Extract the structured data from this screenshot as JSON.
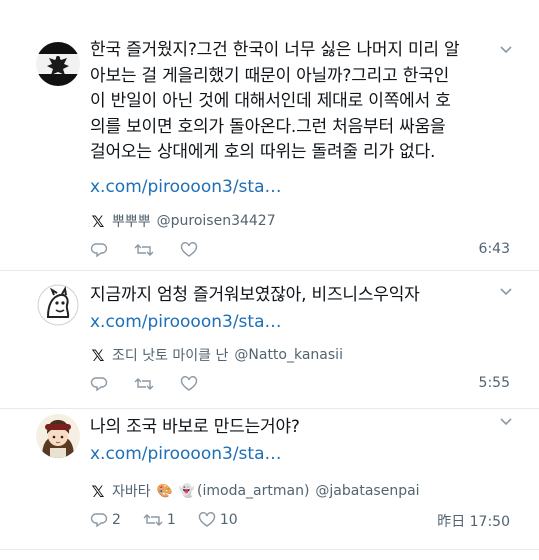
{
  "posts": [
    {
      "lines": [
        "한국 즐거웠지?그건 한국이 너무 싫은 나머지 미리 알",
        "아보는 걸 게을리했기 때문이 아닐까?그리고 한국인",
        "이 반일이 아닌 것에 대해서인데 제대로 이쪽에서 호",
        "의를 보이면 호의가 돌아온다.그런 처음부터 싸움을",
        "걸어오는 상대에게 호의 따위는 돌려줄 리가 없다."
      ],
      "link": "x.com/piroooon3/sta…",
      "quote_name": "뿌뿌뿌",
      "quote_handle": "@puroisen34427",
      "reply_count": "",
      "retweet_count": "",
      "like_count": "",
      "time": "6:43",
      "avatar": "prussian-eagle-avatar-icon"
    },
    {
      "lines": [
        "지금까지 엄청 즐거워보였잖아, 비즈니스우익자"
      ],
      "link": "x.com/piroooon3/sta…",
      "quote_name": "조디 낫토 마이클 난",
      "quote_handle": "@Natto_kanasii",
      "reply_count": "",
      "retweet_count": "",
      "like_count": "",
      "time": "5:55",
      "avatar": "sketch-animal-avatar-icon"
    },
    {
      "lines": [
        "나의 조국 바보로 만드는거야?"
      ],
      "link": "x.com/piroooon3/sta…",
      "quote_name": "자바타",
      "quote_name_suffix": "(imoda_artman)",
      "quote_handle": "@jabatasenpai",
      "reply_count": "2",
      "retweet_count": "1",
      "like_count": "10",
      "time": "昨日 17:50",
      "avatar": "anime-girl-avatar-icon"
    }
  ]
}
